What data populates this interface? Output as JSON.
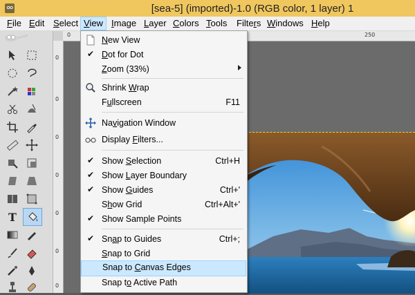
{
  "window": {
    "title": "[sea-5] (imported)-1.0 (RGB color, 1 layer) 1"
  },
  "menubar": {
    "items": [
      {
        "label": "File",
        "u": "F",
        "rest": "ile"
      },
      {
        "label": "Edit",
        "u": "E",
        "rest": "dit"
      },
      {
        "label": "Select",
        "u": "S",
        "rest": "elect"
      },
      {
        "label": "View",
        "u": "V",
        "rest": "iew"
      },
      {
        "label": "Image",
        "u": "I",
        "rest": "mage"
      },
      {
        "label": "Layer",
        "u": "L",
        "rest": "ayer"
      },
      {
        "label": "Colors",
        "u": "C",
        "rest": "olors"
      },
      {
        "label": "Tools",
        "u": "T",
        "rest": "ools"
      },
      {
        "label": "Filters",
        "pre": "Filte",
        "u": "r",
        "rest": "s"
      },
      {
        "label": "Windows",
        "u": "W",
        "rest": "indows"
      },
      {
        "label": "Help",
        "u": "H",
        "rest": "elp"
      }
    ],
    "active": "View"
  },
  "rulers": {
    "top_labels": [
      "0",
      "250"
    ],
    "left_labels": [
      "0",
      "0",
      "0",
      "0",
      "0",
      "0",
      "0"
    ]
  },
  "view_menu": {
    "items": [
      {
        "pre": "",
        "u": "N",
        "rest": "ew View",
        "shortcut": "",
        "check": false,
        "icon": "new-view-icon"
      },
      {
        "pre": "",
        "u": "D",
        "rest": "ot for Dot",
        "shortcut": "",
        "check": true,
        "icon": ""
      },
      {
        "pre": "",
        "u": "Z",
        "rest": "oom (33%)",
        "shortcut": "",
        "check": false,
        "icon": "",
        "submenu": true
      },
      {
        "pre": "Shrink ",
        "u": "W",
        "rest": "rap",
        "shortcut": "",
        "check": false,
        "icon": "zoom-icon"
      },
      {
        "pre": "F",
        "u": "u",
        "rest": "llscreen",
        "shortcut": "F11",
        "check": false,
        "icon": ""
      },
      {
        "pre": "Na",
        "u": "v",
        "rest": "igation Window",
        "shortcut": "",
        "check": false,
        "icon": "navigation-icon"
      },
      {
        "pre": "Display ",
        "u": "F",
        "rest": "ilters...",
        "shortcut": "",
        "check": false,
        "icon": "display-filters-icon"
      },
      {
        "pre": "Show ",
        "u": "S",
        "rest": "election",
        "shortcut": "Ctrl+H",
        "check": true,
        "icon": ""
      },
      {
        "pre": "Show ",
        "u": "L",
        "rest": "ayer Boundary",
        "shortcut": "",
        "check": true,
        "icon": ""
      },
      {
        "pre": "Show ",
        "u": "G",
        "rest": "uides",
        "shortcut": "Ctrl+'",
        "check": true,
        "icon": ""
      },
      {
        "pre": "S",
        "u": "h",
        "rest": "ow Grid",
        "shortcut": "Ctrl+Alt+'",
        "check": false,
        "icon": ""
      },
      {
        "pre": "Show Sample Points",
        "u": "",
        "rest": "",
        "shortcut": "",
        "check": true,
        "icon": ""
      },
      {
        "pre": "Sn",
        "u": "a",
        "rest": "p to Guides",
        "shortcut": "Ctrl+;",
        "check": true,
        "icon": ""
      },
      {
        "pre": "",
        "u": "S",
        "rest": "nap to Grid",
        "shortcut": "",
        "check": false,
        "icon": ""
      },
      {
        "pre": "Snap to ",
        "u": "C",
        "rest": "anvas Edges",
        "shortcut": "",
        "check": false,
        "icon": "",
        "highlighted": true
      },
      {
        "pre": "Snap t",
        "u": "o",
        "rest": " Active Path",
        "shortcut": "",
        "check": false,
        "icon": ""
      }
    ]
  },
  "colors": {
    "titlebar": "#f0c75e",
    "highlight": "#cce8ff",
    "canvas": "#6b6b6b"
  }
}
